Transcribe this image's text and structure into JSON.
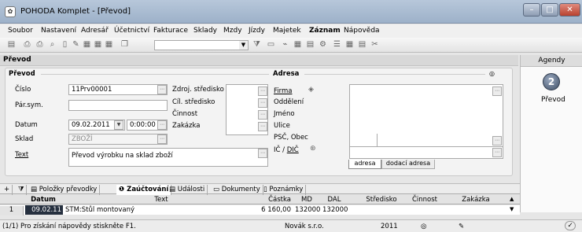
{
  "window": {
    "title": "POHODA Komplet - [Převod]",
    "app_icon": "pohoda-app-icon"
  },
  "menu": [
    "Soubor",
    "Nastavení",
    "Adresář",
    "Účetnictví",
    "Fakturace",
    "Sklady",
    "Mzdy",
    "Jízdy",
    "Majetek",
    "Záznam",
    "Nápověda"
  ],
  "form": {
    "title": "Převod",
    "group_title": "Převod",
    "cislo_label": "Číslo",
    "cislo_value": "11Prv00001",
    "parsym_label": "Pár.sym.",
    "parsym_value": "",
    "datum_label": "Datum",
    "datum_value": "09.02.2011",
    "time_value": "0:00:00",
    "sklad_label": "Sklad",
    "sklad_value": "ZBOŽÍ",
    "text_label": "Text",
    "text_value": "Převod výrobku na sklad zboží",
    "zdroj_label": "Zdroj. středisko",
    "cil_label": "Cíl. středisko",
    "cinnost_label": "Činnost",
    "zakazka_label": "Zakázka",
    "adresa_group": "Adresa",
    "firma_label": "Firma",
    "oddeleni_label": "Oddělení",
    "jmeno_label": "Jméno",
    "ulice_label": "Ulice",
    "psc_label": "PSČ, Obec",
    "ic_label": "IČ / ",
    "dic_label": "DIČ",
    "addr_tab1": "adresa",
    "addr_tab2": "dodací adresa"
  },
  "agenda": {
    "header": "Agendy",
    "item": "Převod"
  },
  "tabs": [
    "Položky převodky",
    "Zaúčtování",
    "Události",
    "Dokumenty",
    "Poznámky"
  ],
  "grid": {
    "headers": [
      "Datum",
      "Text",
      "Částka",
      "MD",
      "DAL",
      "Středisko",
      "Činnost",
      "Zakázka"
    ],
    "row": {
      "num": "1",
      "datum": "09.02.11",
      "text": "STM:Stůl montovaný",
      "castka": "6 160,00",
      "md": "132000",
      "dal": "132000"
    }
  },
  "status": {
    "help": "(1/1) Pro získání nápovědy stiskněte F1.",
    "company": "Novák s.r.o.",
    "year": "2011"
  }
}
